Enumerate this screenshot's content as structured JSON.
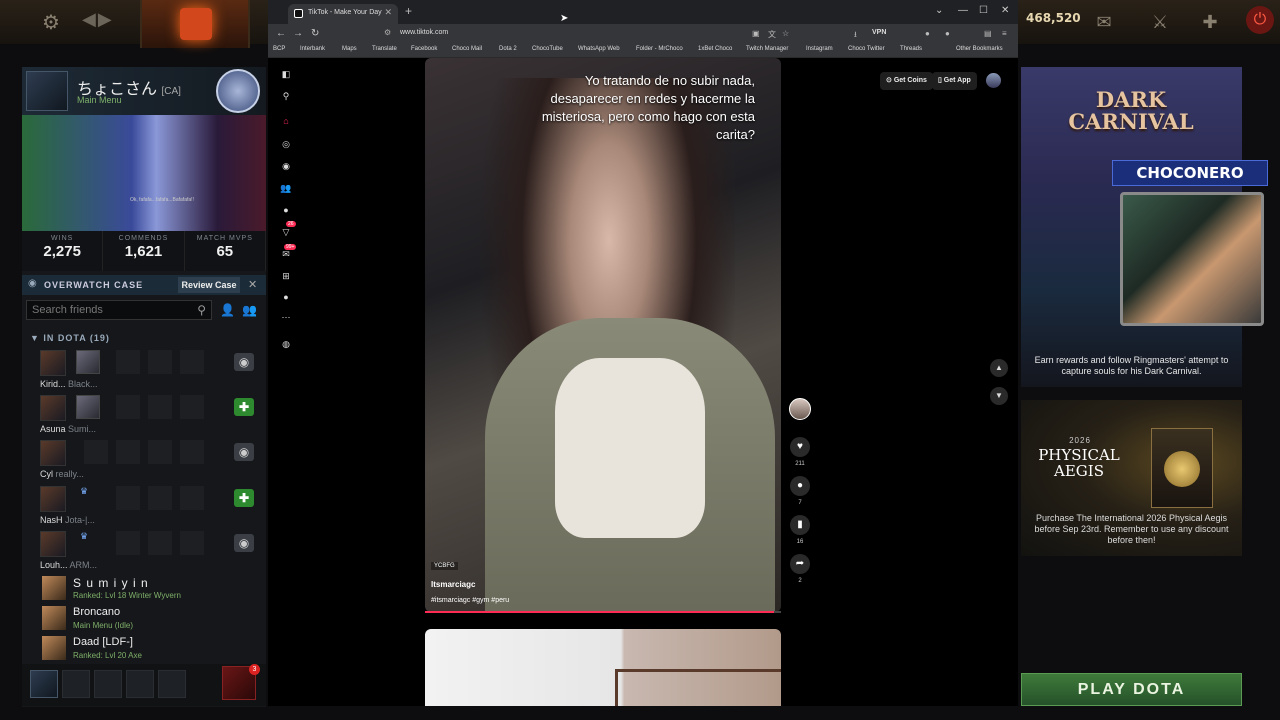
{
  "dota": {
    "coins": "468,520",
    "profile": {
      "name": "ちょこさん",
      "tag": "[CA]",
      "status": "Main Menu",
      "banner_text": "Ok, fafafa...fafafa...Bafafafa!!"
    },
    "stats": [
      {
        "label": "WINS",
        "value": "2,275"
      },
      {
        "label": "COMMENDS",
        "value": "1,621"
      },
      {
        "label": "MATCH MVPS",
        "value": "65"
      }
    ],
    "overwatch": {
      "label": "OVERWATCH CASE",
      "review": "Review Case"
    },
    "search_placeholder": "Search friends",
    "section": "IN DOTA (19)",
    "friends_in_dota": [
      {
        "name": "Kirid...",
        "status": "Black...",
        "action": "eye"
      },
      {
        "name": "Asuna",
        "status": "Sumi...",
        "action": "plus"
      },
      {
        "name": "Cyl",
        "status": "really...",
        "action": "eye"
      },
      {
        "name": "NasH",
        "status": "Jota-|...",
        "action": "plus"
      },
      {
        "name": "Louh...",
        "status": "ARM...",
        "action": "eye"
      }
    ],
    "friends": [
      {
        "name": "S u m i y i n",
        "status": "Ranked: Lvl 18 Winter Wyvern"
      },
      {
        "name": "Broncano",
        "status": "Main Menu (Idle)"
      },
      {
        "name": "Daad [LDF-]",
        "status": "Ranked: Lvl 20 Axe"
      }
    ],
    "chat_badge": "3",
    "carnival": {
      "title": "DARK CARNIVAL",
      "desc": "Earn rewards and follow Ringmasters' attempt to capture souls for his Dark Carnival."
    },
    "aegis": {
      "year": "2026",
      "title": "PHYSICAL AEGIS",
      "desc": "Purchase The International 2026 Physical Aegis before Sep 23rd. Remember to use any discount before then!"
    },
    "play_button": "PLAY DOTA"
  },
  "stream": {
    "name": "CHOCONERO"
  },
  "browser": {
    "tab_title": "TikTok - Make Your Day",
    "url": "www.tiktok.com",
    "vpn": "VPN",
    "bookmarks": [
      "BCP",
      "Interbank",
      "Maps",
      "Translate",
      "Facebook",
      "Choco Mail",
      "Dota 2",
      "ChocoTube",
      "WhatsApp Web",
      "Folder - MrChoco",
      "1xBet Choco",
      "Twitch Manager",
      "Instagram",
      "Choco Twitter",
      "Threads",
      "Other Bookmarks"
    ]
  },
  "tiktok": {
    "overlay_text": "Yo tratando de no subir nada, desaparecer en redes y hacerme la misteriosa, pero como hago con esta carita?",
    "badge": "YCBFG",
    "author": "Itsmarciagc",
    "caption": "#itsmarciagc #gym #peru",
    "likes": "211",
    "comments": "7",
    "saves": "16",
    "shares": "2",
    "get_coins": "Get Coins",
    "get_app": "Get App",
    "sidebar_badges": [
      "26",
      "99+"
    ],
    "progress": 0.98
  },
  "colors": {
    "tiktok_accent": "#fe2c55",
    "dota_play": "#3e7a3a"
  }
}
